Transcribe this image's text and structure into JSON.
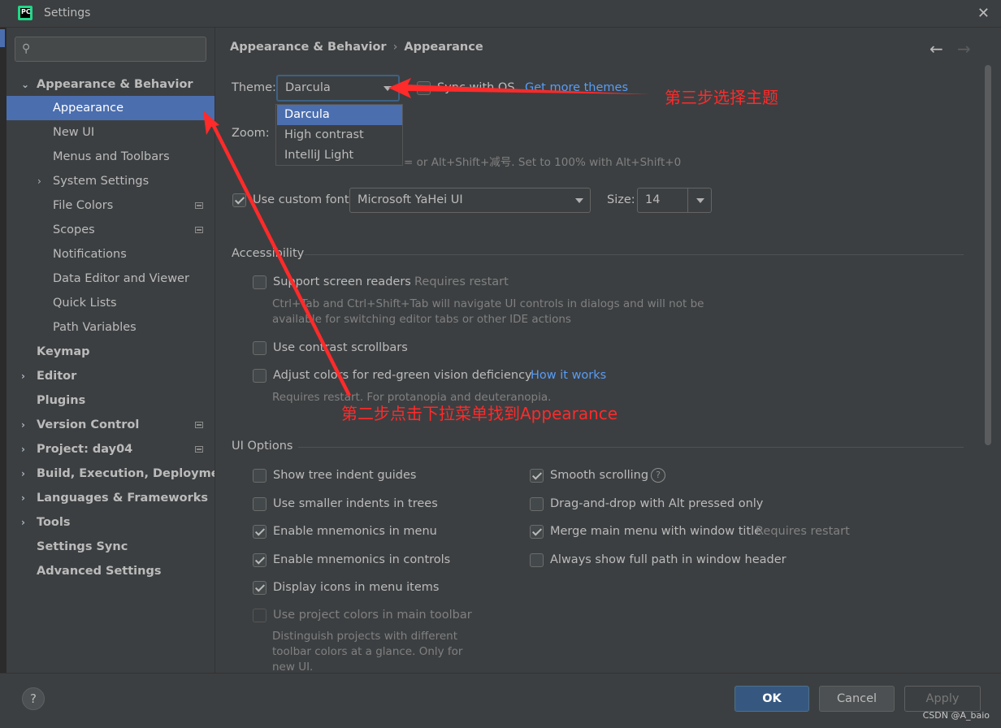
{
  "window": {
    "title": "Settings",
    "app_icon_text": "PC"
  },
  "sidebar": {
    "search_placeholder": "",
    "items": [
      {
        "label": "Appearance & Behavior",
        "expanded": true
      },
      {
        "label": "Appearance"
      },
      {
        "label": "New UI"
      },
      {
        "label": "Menus and Toolbars"
      },
      {
        "label": "System Settings"
      },
      {
        "label": "File Colors"
      },
      {
        "label": "Scopes"
      },
      {
        "label": "Notifications"
      },
      {
        "label": "Data Editor and Viewer"
      },
      {
        "label": "Quick Lists"
      },
      {
        "label": "Path Variables"
      },
      {
        "label": "Keymap"
      },
      {
        "label": "Editor"
      },
      {
        "label": "Plugins"
      },
      {
        "label": "Version Control"
      },
      {
        "label": "Project: day04"
      },
      {
        "label": "Build, Execution, Deployment"
      },
      {
        "label": "Languages & Frameworks"
      },
      {
        "label": "Tools"
      },
      {
        "label": "Settings Sync"
      },
      {
        "label": "Advanced Settings"
      }
    ]
  },
  "breadcrumb": {
    "parent": "Appearance & Behavior",
    "sep": "›",
    "current": "Appearance"
  },
  "theme": {
    "label": "Theme:",
    "value": "Darcula",
    "sync_label": "Sync with OS",
    "get_more": "Get more themes",
    "options": [
      "Darcula",
      "High contrast",
      "IntelliJ Light"
    ]
  },
  "zoom": {
    "label": "Zoom:",
    "hint": "= or Alt+Shift+减号. Set to 100% with Alt+Shift+0"
  },
  "font": {
    "use_custom_label": "Use custom font:",
    "font_value": "Microsoft YaHei UI",
    "size_label": "Size:",
    "size_value": "14"
  },
  "accessibility": {
    "title": "Accessibility",
    "screen_readers": "Support screen readers",
    "requires_restart": "Requires restart",
    "sr_desc_1": "Ctrl+Tab and Ctrl+Shift+Tab will navigate UI controls in dialogs and will not be",
    "sr_desc_2": "available for switching editor tabs or other IDE actions",
    "contrast_scrollbars": "Use contrast scrollbars",
    "adjust_colors": "Adjust colors for red-green vision deficiency",
    "how_it_works": "How it works",
    "adjust_desc": "Requires restart. For protanopia and deuteranopia."
  },
  "ui_options": {
    "title": "UI Options",
    "left": [
      {
        "label": "Show tree indent guides",
        "checked": false
      },
      {
        "label": "Use smaller indents in trees",
        "checked": false
      },
      {
        "label": "Enable mnemonics in menu",
        "checked": true
      },
      {
        "label": "Enable mnemonics in controls",
        "checked": true
      },
      {
        "label": "Display icons in menu items",
        "checked": true
      },
      {
        "label": "Use project colors in main toolbar",
        "checked": false
      }
    ],
    "project_colors_desc_1": "Distinguish projects with different",
    "project_colors_desc_2": "toolbar colors at a glance. Only for",
    "project_colors_desc_3": "new UI.",
    "right": [
      {
        "label": "Smooth scrolling",
        "checked": true
      },
      {
        "label": "Drag-and-drop with Alt pressed only",
        "checked": false
      },
      {
        "label": "Merge main menu with window title",
        "checked": true
      },
      {
        "label": "Always show full path in window header",
        "checked": false
      }
    ],
    "merge_requires_restart": "Requires restart",
    "help_glyph": "?"
  },
  "footer": {
    "help": "?",
    "ok": "OK",
    "cancel": "Cancel",
    "apply": "Apply"
  },
  "annotations": {
    "step3": "第三步选择主题",
    "step2": "第二步点击下拉菜单找到Appearance",
    "color": "#ff2a2a"
  },
  "watermark": "CSDN @A_baio"
}
